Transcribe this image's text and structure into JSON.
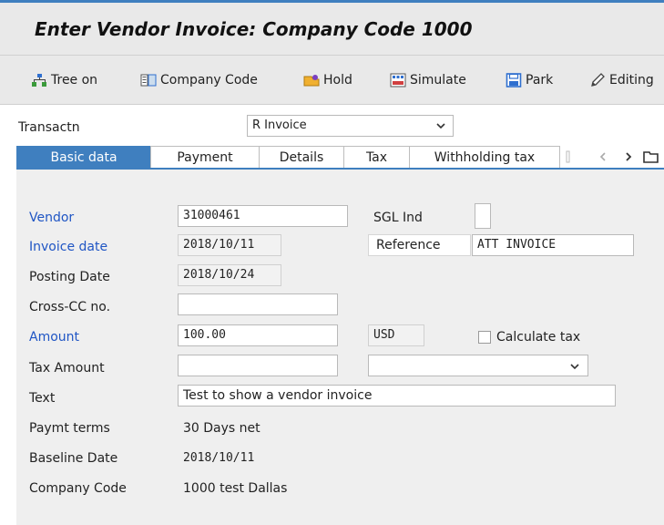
{
  "window": {
    "title": "Enter Vendor Invoice: Company Code 1000"
  },
  "toolbar": {
    "tree_on": "Tree on",
    "company_code": "Company Code",
    "hold": "Hold",
    "simulate": "Simulate",
    "park": "Park",
    "editing": "Editing"
  },
  "transaction": {
    "label": "Transactn",
    "value": "R Invoice"
  },
  "tabs": [
    {
      "label": "Basic data",
      "active": true
    },
    {
      "label": "Payment"
    },
    {
      "label": "Details"
    },
    {
      "label": "Tax"
    },
    {
      "label": "Withholding tax"
    }
  ],
  "form": {
    "vendor": {
      "label": "Vendor",
      "value": "31000461"
    },
    "sgl_ind": {
      "label": "SGL Ind",
      "value": ""
    },
    "invoice_date": {
      "label": "Invoice date",
      "value": "2018/10/11"
    },
    "reference": {
      "label": "Reference",
      "value": "ATT INVOICE"
    },
    "posting_date": {
      "label": "Posting Date",
      "value": "2018/10/24"
    },
    "cross_cc": {
      "label": "Cross-CC no.",
      "value": ""
    },
    "amount": {
      "label": "Amount",
      "value": "100.00"
    },
    "currency": {
      "value": "USD"
    },
    "calculate_tax": {
      "label": "Calculate tax",
      "checked": false
    },
    "tax_amount": {
      "label": "Tax Amount",
      "value": ""
    },
    "tax_code": {
      "value": ""
    },
    "text": {
      "label": "Text",
      "value": "Test to show a vendor invoice"
    },
    "paymt_terms": {
      "label": "Paymt terms",
      "value": "30 Days net"
    },
    "baseline_date": {
      "label": "Baseline Date",
      "value": "2018/10/11"
    },
    "company_code": {
      "label": "Company Code",
      "value": "1000 test Dallas"
    }
  },
  "colors": {
    "accent": "#3f7fbf",
    "link_label": "#1f55c4",
    "panel": "#efefef",
    "toolbar": "#e9e9e9"
  }
}
